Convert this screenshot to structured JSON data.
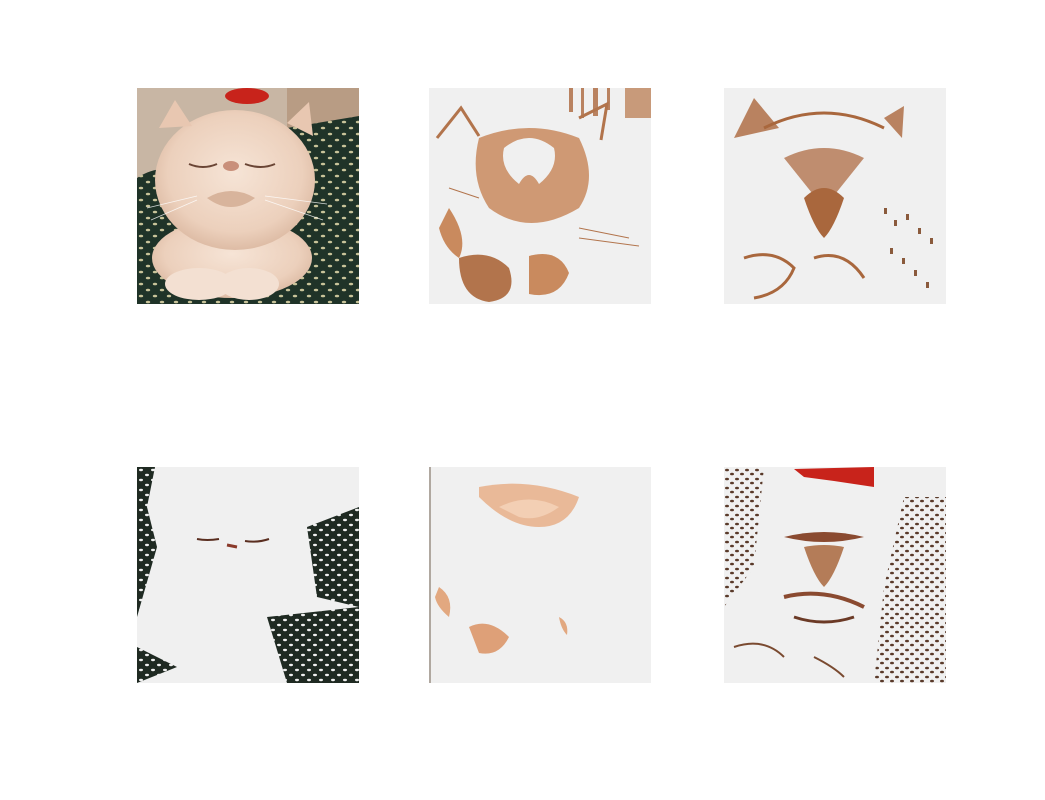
{
  "figure": {
    "background": "#ffffff",
    "panel_count": 6,
    "panels": [
      {
        "name": "original-photo",
        "subject": "cat"
      },
      {
        "name": "segment-mask-1",
        "subject": "cat"
      },
      {
        "name": "segment-mask-2",
        "subject": "cat"
      },
      {
        "name": "segment-mask-3",
        "subject": "cat"
      },
      {
        "name": "segment-mask-4",
        "subject": "cat"
      },
      {
        "name": "segment-mask-5",
        "subject": "cat"
      }
    ]
  },
  "colors": {
    "mask_background": "#f0f0f0",
    "fur_light": "#f2d9c8",
    "fur_mid": "#d9a27a",
    "fur_dark": "#b86a3a",
    "sofa_dark": "#1f3328",
    "sofa_dots": "#d4cfa0",
    "bow_red": "#c8231b"
  }
}
